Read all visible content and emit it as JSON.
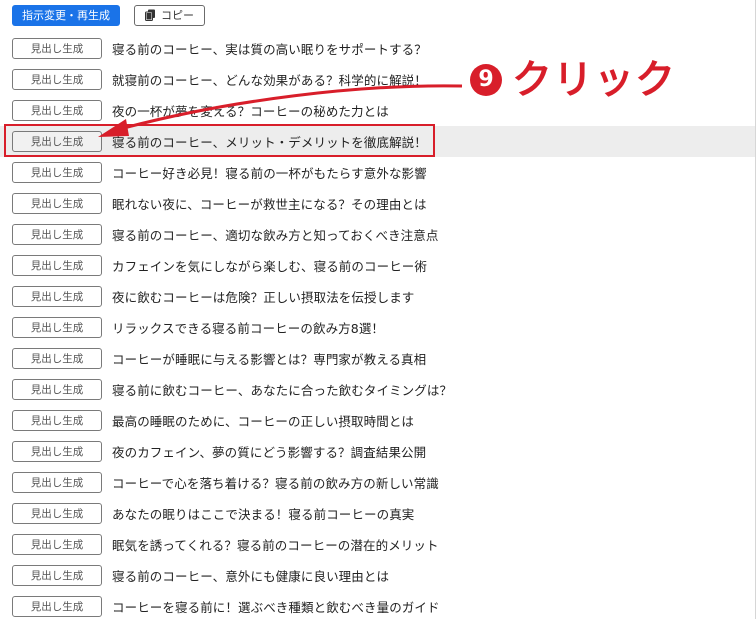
{
  "toolbar": {
    "regenerate_label": "指示変更・再生成",
    "copy_label": "コピー"
  },
  "annotation": {
    "number": "9",
    "text": "クリック",
    "color": "#d81e2a"
  },
  "colors": {
    "primary": "#1a73e8",
    "annotation": "#d81e2a",
    "highlight_row": "#ededed"
  },
  "generate_button_label": "見出し生成",
  "highlighted_row_index": 3,
  "rows": [
    {
      "button": "見出し生成",
      "title": "寝る前のコーヒー、実は質の高い眠りをサポートする？"
    },
    {
      "button": "見出し生成",
      "title": "就寝前のコーヒー、どんな効果がある？科学的に解説！"
    },
    {
      "button": "見出し生成",
      "title": "夜の一杯が夢を変える？コーヒーの秘めた力とは"
    },
    {
      "button": "見出し生成",
      "title": "寝る前のコーヒー、メリット・デメリットを徹底解説！"
    },
    {
      "button": "見出し生成",
      "title": "コーヒー好き必見！寝る前の一杯がもたらす意外な影響"
    },
    {
      "button": "見出し生成",
      "title": "眠れない夜に、コーヒーが救世主になる？その理由とは"
    },
    {
      "button": "見出し生成",
      "title": "寝る前のコーヒー、適切な飲み方と知っておくべき注意点"
    },
    {
      "button": "見出し生成",
      "title": "カフェインを気にしながら楽しむ、寝る前のコーヒー術"
    },
    {
      "button": "見出し生成",
      "title": "夜に飲むコーヒーは危険？正しい摂取法を伝授します"
    },
    {
      "button": "見出し生成",
      "title": "リラックスできる寝る前コーヒーの飲み方8選！"
    },
    {
      "button": "見出し生成",
      "title": "コーヒーが睡眠に与える影響とは？専門家が教える真相"
    },
    {
      "button": "見出し生成",
      "title": "寝る前に飲むコーヒー、あなたに合った飲むタイミングは？"
    },
    {
      "button": "見出し生成",
      "title": "最高の睡眠のために、コーヒーの正しい摂取時間とは"
    },
    {
      "button": "見出し生成",
      "title": "夜のカフェイン、夢の質にどう影響する？調査結果公開"
    },
    {
      "button": "見出し生成",
      "title": "コーヒーで心を落ち着ける？寝る前の飲み方の新しい常識"
    },
    {
      "button": "見出し生成",
      "title": "あなたの眠りはここで決まる！寝る前コーヒーの真実"
    },
    {
      "button": "見出し生成",
      "title": "眠気を誘ってくれる？寝る前のコーヒーの潜在的メリット"
    },
    {
      "button": "見出し生成",
      "title": "寝る前のコーヒー、意外にも健康に良い理由とは"
    },
    {
      "button": "見出し生成",
      "title": "コーヒーを寝る前に！選ぶべき種類と飲むべき量のガイド"
    }
  ]
}
